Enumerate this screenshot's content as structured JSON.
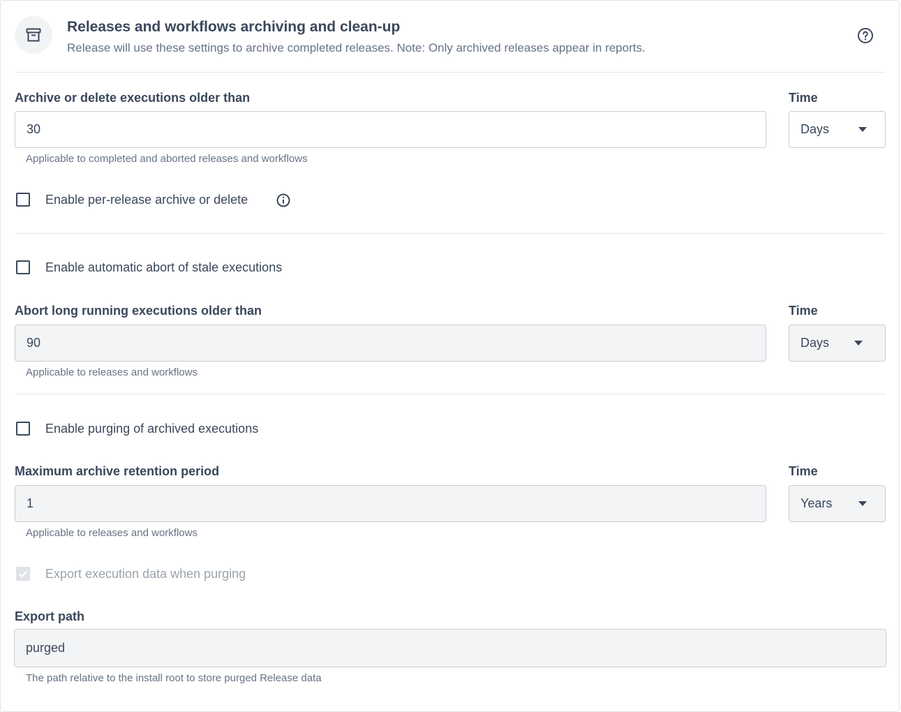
{
  "header": {
    "title": "Releases and workflows archiving and clean-up",
    "subtitle": "Release will use these settings to archive completed releases. Note: Only archived releases appear in reports.",
    "icon": "archive-box-icon",
    "help_icon": "help-circle-icon"
  },
  "archive": {
    "label": "Archive or delete executions older than",
    "value": "30",
    "time_label": "Time",
    "time_value": "Days",
    "helper": "Applicable to completed and aborted releases and workflows",
    "per_release_label": "Enable per-release archive or delete",
    "per_release_checked": false
  },
  "abort": {
    "enable_label": "Enable automatic abort of stale executions",
    "enable_checked": false,
    "label": "Abort long running executions older than",
    "value": "90",
    "time_label": "Time",
    "time_value": "Days",
    "helper": "Applicable to releases and workflows"
  },
  "purge": {
    "enable_label": "Enable purging of archived executions",
    "enable_checked": false,
    "label": "Maximum archive retention period",
    "value": "1",
    "time_label": "Time",
    "time_value": "Years",
    "helper": "Applicable to releases and workflows",
    "export_label": "Export execution data when purging",
    "export_checked": true,
    "export_path_label": "Export path",
    "export_path_value": "purged",
    "export_path_helper": "The path relative to the install root to store purged Release data"
  },
  "colors": {
    "text": "#3b485c",
    "muted": "#667385",
    "border": "#c9ced6",
    "disabled_bg": "#f3f4f6"
  }
}
